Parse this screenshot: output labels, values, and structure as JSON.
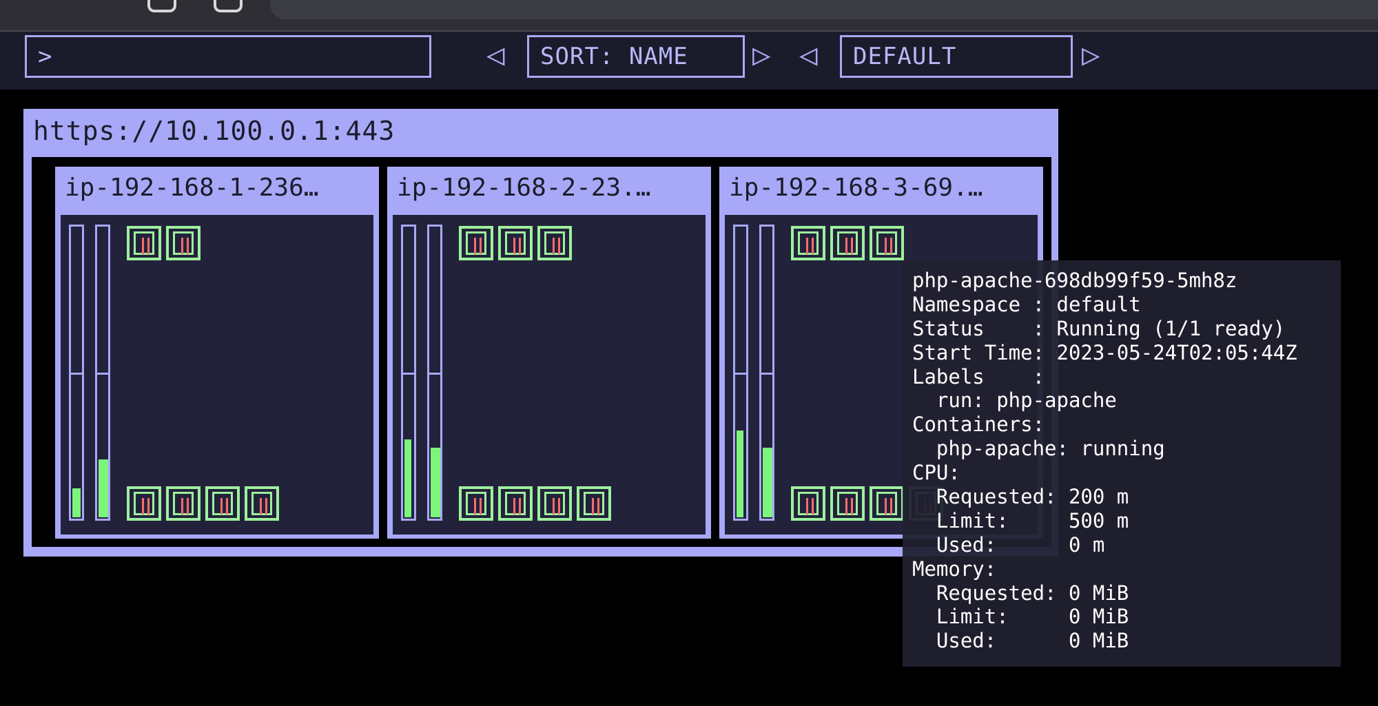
{
  "toolbar": {
    "filter_value": ">",
    "sort_label": "SORT: NAME",
    "color_label": "DEFAULT",
    "prev_symbol": "◁",
    "next_symbol": "▷"
  },
  "cluster": {
    "title": "https://10.100.0.1:443",
    "nodes": [
      {
        "name": "ip-192-168-1-236…",
        "cpu_fill": 0.1,
        "mem_fill": 0.2,
        "top_pods": 2,
        "bottom_pods": 4
      },
      {
        "name": "ip-192-168-2-23.…",
        "cpu_fill": 0.27,
        "mem_fill": 0.24,
        "top_pods": 3,
        "bottom_pods": 4
      },
      {
        "name": "ip-192-168-3-69.…",
        "cpu_fill": 0.3,
        "mem_fill": 0.24,
        "top_pods": 3,
        "bottom_pods": 4
      }
    ]
  },
  "tooltip": {
    "lines": [
      "php-apache-698db99f59-5mh8z",
      "Namespace : default",
      "Status    : Running (1/1 ready)",
      "Start Time: 2023-05-24T02:05:44Z",
      "Labels    :",
      "  run: php-apache",
      "Containers:",
      "  php-apache: running",
      "CPU:",
      "  Requested: 200 m",
      "  Limit:     500 m",
      "  Used:      0 m",
      "Memory:",
      "  Requested: 0 MiB",
      "  Limit:     0 MiB",
      "  Used:      0 MiB"
    ]
  },
  "colors": {
    "accent": "#a8a8f9",
    "node_body": "#22223a",
    "pod_ok": "#9ef09e",
    "usage_fill": "#7cf57c",
    "pod_marker": "#ff6c6c"
  }
}
